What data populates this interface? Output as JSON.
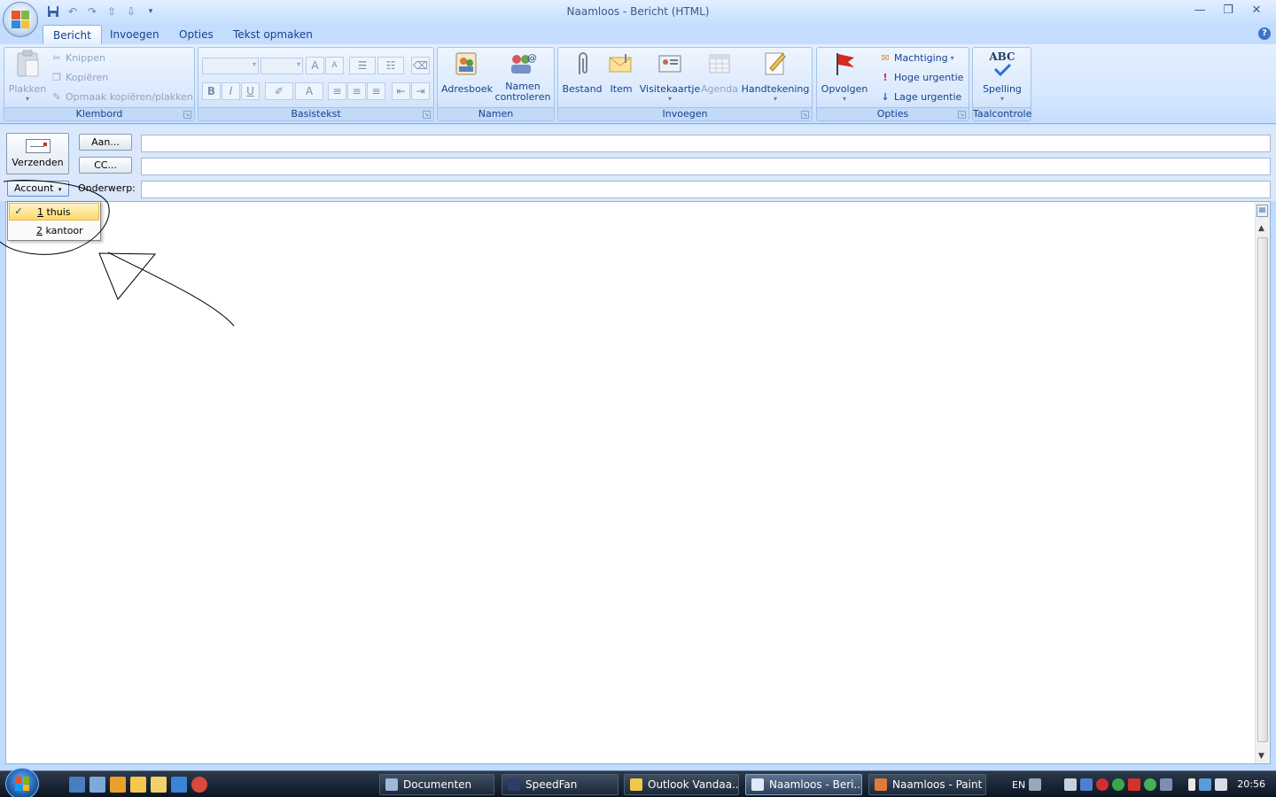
{
  "window": {
    "title": "Naamloos - Bericht (HTML)",
    "minimize": "—",
    "restore": "❐",
    "close": "✕"
  },
  "tabs": [
    "Bericht",
    "Invoegen",
    "Opties",
    "Tekst opmaken"
  ],
  "help": "?",
  "ribbon": {
    "klembord": {
      "label": "Klembord",
      "plakken": "Plakken",
      "knippen": "Knippen",
      "kopieren": "Kopiëren",
      "opmaak": "Opmaak kopiëren/plakken"
    },
    "basistekst": {
      "label": "Basistekst",
      "bold": "B",
      "italic": "I",
      "underline": "U",
      "grow": "A",
      "shrink": "A",
      "font_color": "A"
    },
    "namen": {
      "label": "Namen",
      "adresboek": "Adresboek",
      "namen_controleren_1": "Namen",
      "namen_controleren_2": "controleren"
    },
    "invoegen": {
      "label": "Invoegen",
      "bestand": "Bestand",
      "item": "Item",
      "visitekaartje": "Visitekaartje",
      "agenda": "Agenda",
      "handtekening": "Handtekening"
    },
    "opties": {
      "label": "Opties",
      "opvolgen": "Opvolgen",
      "machtiging": "Machtiging",
      "hoge_urgentie": "Hoge urgentie",
      "lage_urgentie": "Lage urgentie"
    },
    "taalcontrole": {
      "label": "Taalcontrole",
      "spelling": "Spelling",
      "abc": "ABC"
    }
  },
  "header": {
    "send": "Verzenden",
    "to": "Aan...",
    "cc": "CC...",
    "account": "Account",
    "subject_label": "Onderwerp:",
    "to_value": "",
    "cc_value": "",
    "subject_value": ""
  },
  "account_menu": [
    {
      "num": "1",
      "label": " thuis",
      "checked": true
    },
    {
      "num": "2",
      "label": " kantoor",
      "checked": false
    }
  ],
  "taskbar": {
    "tasks": [
      "Documenten",
      "SpeedFan",
      "Outlook Vandaa...",
      "Naamloos - Beri...",
      "Naamloos - Paint"
    ],
    "lang": "EN",
    "clock": "20:56"
  },
  "colors": {
    "ribbon_bg": "#dbe8fb",
    "text_blue": "#15428b",
    "menu_highlight": "#ffd96b"
  }
}
